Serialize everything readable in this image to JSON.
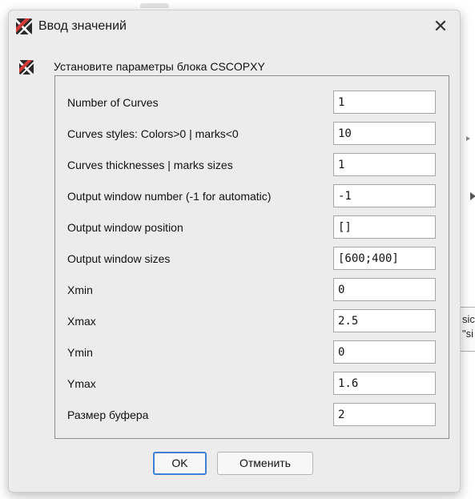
{
  "background": {
    "block_text": "sic\n\"si"
  },
  "dialog": {
    "title": "Ввод значений",
    "prompt": "Установите параметры блока CSCOPXY",
    "fields": [
      {
        "label": "Number of Curves",
        "value": "1"
      },
      {
        "label": "Curves styles: Colors>0 | marks<0",
        "value": "10"
      },
      {
        "label": "Curves thicknesses | marks sizes",
        "value": "1"
      },
      {
        "label": "Output window number (-1 for automatic)",
        "value": "-1"
      },
      {
        "label": "Output window position",
        "value": "[]"
      },
      {
        "label": "Output window sizes",
        "value": "[600;400]"
      },
      {
        "label": "Xmin",
        "value": "0"
      },
      {
        "label": "Xmax",
        "value": "2.5"
      },
      {
        "label": "Ymin",
        "value": "0"
      },
      {
        "label": "Ymax",
        "value": "1.6"
      },
      {
        "label": "Размер буфера",
        "value": "2"
      }
    ],
    "buttons": {
      "ok": "OK",
      "cancel": "Отменить"
    },
    "icons": {
      "app": "scilab-block-icon",
      "close": "close-icon"
    },
    "colors": {
      "ok_focus_border": "#3b82d6",
      "dialog_bg": "#ececec"
    }
  }
}
